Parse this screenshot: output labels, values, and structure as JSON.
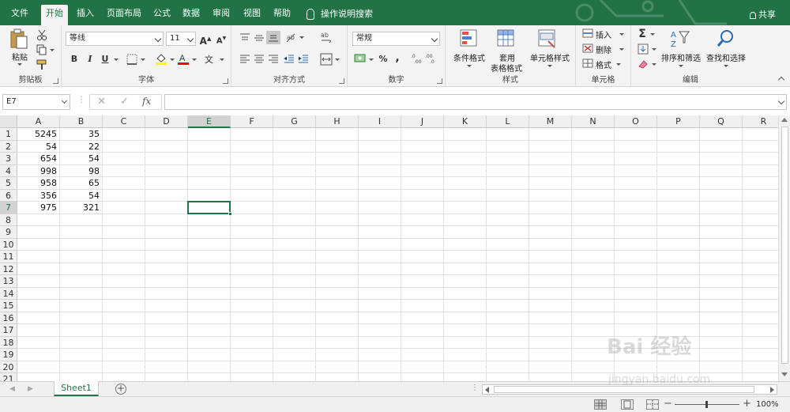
{
  "tabs": [
    "文件",
    "开始",
    "插入",
    "页面布局",
    "公式",
    "数据",
    "审阅",
    "视图",
    "帮助"
  ],
  "tell_me": "操作说明搜索",
  "share": "共享",
  "ribbon": {
    "clipboard": {
      "paste": "粘贴",
      "label": "剪贴板"
    },
    "font": {
      "name": "等线",
      "size": "11",
      "label": "字体",
      "bold": "B",
      "italic": "I",
      "underline": "U",
      "grow": "A",
      "shrink": "A",
      "fill_color": "#ffff00",
      "font_color": "#ff0000"
    },
    "align": {
      "label": "对齐方式"
    },
    "number": {
      "format": "常规",
      "label": "数字",
      "percent": "%",
      "comma": ","
    },
    "styles": {
      "cond": "条件格式",
      "table1": "套用",
      "table2": "表格格式",
      "cell": "单元格样式",
      "label": "样式"
    },
    "cells": {
      "insert": "插入",
      "delete": "删除",
      "format": "格式",
      "label": "单元格"
    },
    "editing": {
      "sort": "排序和筛选",
      "find": "查找和选择",
      "label": "编辑",
      "sigma": "Σ"
    }
  },
  "formula_bar": {
    "name_box": "E7",
    "fx": "fx",
    "value": ""
  },
  "columns": [
    "A",
    "B",
    "C",
    "D",
    "E",
    "F",
    "G",
    "H",
    "I",
    "J",
    "K",
    "L",
    "M",
    "N",
    "O",
    "P",
    "Q",
    "R"
  ],
  "rows": [
    "1",
    "2",
    "3",
    "4",
    "5",
    "6",
    "7",
    "8",
    "9",
    "10",
    "11",
    "12",
    "13",
    "14",
    "15",
    "16",
    "17",
    "18",
    "19",
    "20",
    "21"
  ],
  "cells": {
    "A": [
      "5245",
      "54",
      "654",
      "998",
      "958",
      "356",
      "975"
    ],
    "B": [
      "35",
      "22",
      "54",
      "98",
      "65",
      "54",
      "321"
    ]
  },
  "active_cell": "E7",
  "sheet": {
    "name": "Sheet1",
    "add": "+"
  },
  "status": {
    "zoom": "100%",
    "minus": "−",
    "plus": "+"
  },
  "watermark": {
    "brand": "Bai 经验",
    "url": "jingyan.baidu.com"
  },
  "colors": {
    "accent": "#217346"
  }
}
